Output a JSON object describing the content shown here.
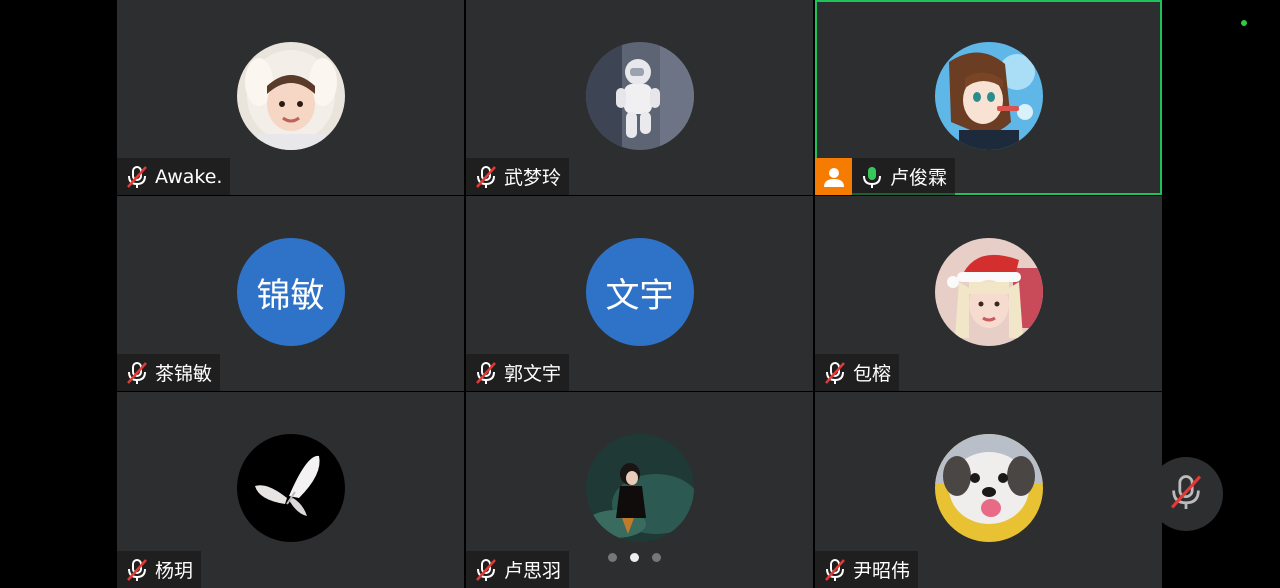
{
  "participants": [
    {
      "name": "Awake.",
      "avatar_type": "photo",
      "avatar_desc": "child-hood-icon",
      "mic": "muted"
    },
    {
      "name": "武梦玲",
      "avatar_type": "photo",
      "avatar_desc": "astronaut-icon",
      "mic": "muted"
    },
    {
      "name": "卢俊霖",
      "avatar_type": "photo",
      "avatar_desc": "anime-girl-icon",
      "mic": "on",
      "host": true,
      "active_speaker": true
    },
    {
      "name": "茶锦敏",
      "avatar_type": "initials",
      "initials": "锦敏",
      "mic": "muted"
    },
    {
      "name": "郭文宇",
      "avatar_type": "initials",
      "initials": "文宇",
      "mic": "muted"
    },
    {
      "name": "包榕",
      "avatar_type": "photo",
      "avatar_desc": "santa-hat-girl-icon",
      "mic": "muted"
    },
    {
      "name": "杨玥",
      "avatar_type": "photo",
      "avatar_desc": "butterfly-icon",
      "mic": "muted"
    },
    {
      "name": "卢思羽",
      "avatar_type": "photo",
      "avatar_desc": "pond-girl-icon",
      "mic": "muted"
    },
    {
      "name": "尹昭伟",
      "avatar_type": "photo",
      "avatar_desc": "puppy-icon",
      "mic": "muted"
    }
  ],
  "pagination": {
    "pages": 3,
    "current": 2
  },
  "controls": {
    "self_mic": "muted",
    "self_mic_icon": "mic-muted-icon"
  },
  "colors": {
    "active_border": "#1fc25a",
    "host_badge": "#f57c00",
    "initials_bg": "#2f73c9",
    "mute_red": "#e53935",
    "mic_green": "#34c759"
  }
}
